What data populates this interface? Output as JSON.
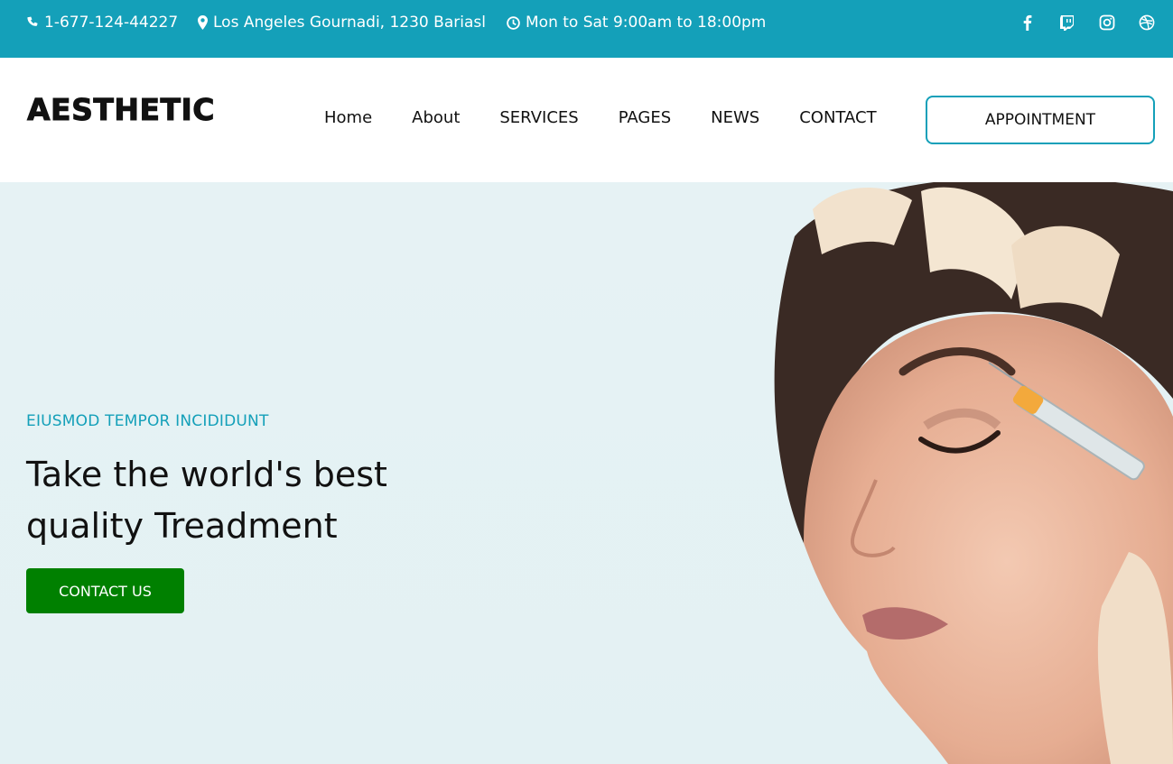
{
  "topbar": {
    "phone": "1-677-124-44227",
    "address": "Los Angeles Gournadi, 1230 Bariasl",
    "hours": "Mon to Sat 9:00am to 18:00pm",
    "socials": [
      "facebook-icon",
      "twitch-icon",
      "instagram-icon",
      "dribbble-icon"
    ],
    "bg_color": "#14a0b9"
  },
  "header": {
    "logo": "AESTHETIC",
    "nav": [
      "Home",
      "About",
      "SERVICES",
      "PAGES",
      "NEWS",
      "CONTACT"
    ],
    "appointment_label": "APPOINTMENT"
  },
  "hero": {
    "eyebrow": "EIUSMOD TEMPOR INCIDIDUNT",
    "headline_line1": "Take the world's best",
    "headline_line2": "quality Treadment",
    "cta_label": "CONTACT US",
    "cta_color": "#008000",
    "accent_color": "#14a0b9"
  }
}
